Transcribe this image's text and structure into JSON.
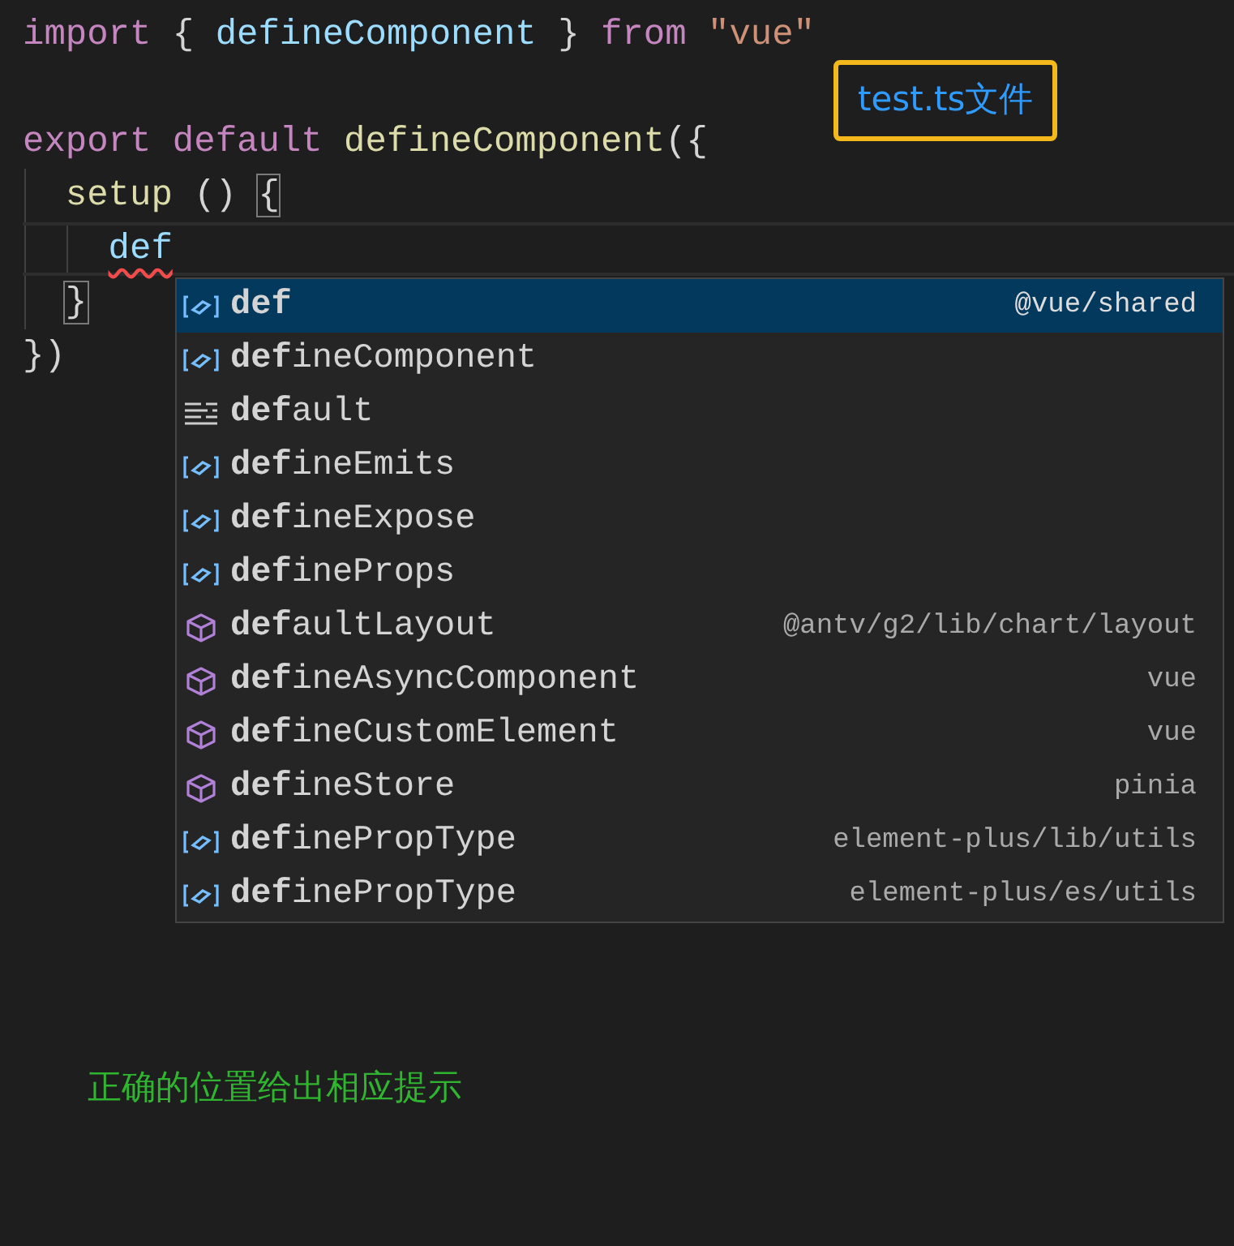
{
  "editor": {
    "blocks": [
      {
        "lines": [
          {
            "current": false,
            "tokens": [
              {
                "kind": "keyword",
                "text": "import"
              },
              {
                "kind": "punct",
                "text": " { "
              },
              {
                "kind": "ident",
                "text": "defineComponent"
              },
              {
                "kind": "punct",
                "text": " } "
              },
              {
                "kind": "keyword",
                "text": "from"
              },
              {
                "kind": "string",
                "text": " \"vue\""
              }
            ]
          }
        ]
      },
      {
        "lines": [
          {
            "current": false,
            "tokens": [
              {
                "kind": "keyword",
                "text": "export"
              },
              {
                "kind": "keyword",
                "text": " default"
              },
              {
                "kind": "function",
                "text": " defineComponent"
              },
              {
                "kind": "punct",
                "text": "({"
              }
            ],
            "children": [
              {
                "current": false,
                "tokens": [
                  {
                    "kind": "function",
                    "text": "setup"
                  },
                  {
                    "kind": "punct",
                    "text": " () "
                  },
                  {
                    "kind": "bracket",
                    "text": "{"
                  }
                ],
                "children": [
                  {
                    "current": true,
                    "tokens": [
                      {
                        "kind": "ident",
                        "text": "def",
                        "error": true
                      }
                    ]
                  }
                ]
              },
              {
                "current": false,
                "tokens": [
                  {
                    "kind": "bracket",
                    "text": "}"
                  }
                ]
              }
            ]
          },
          {
            "current": false,
            "tokens": [
              {
                "kind": "punct",
                "text": "})"
              }
            ]
          }
        ]
      }
    ]
  },
  "suggestions": [
    {
      "kind": "variable",
      "label": "**def**",
      "detail": "@vue/shared",
      "selected": true
    },
    {
      "kind": "variable",
      "label": "**def**ineComponent",
      "selected": false
    },
    {
      "kind": "text",
      "label": "**def**ault",
      "selected": false
    },
    {
      "kind": "variable",
      "label": "**def**ineEmits",
      "selected": false
    },
    {
      "kind": "variable",
      "label": "**def**ineExpose",
      "selected": false
    },
    {
      "kind": "variable",
      "label": "**def**ineProps",
      "selected": false
    },
    {
      "kind": "module",
      "label": "**def**aultLayout",
      "detail": "@antv/g2/lib/chart/layout",
      "selected": false
    },
    {
      "kind": "module",
      "label": "**def**ineAsyncComponent",
      "detail": "vue",
      "selected": false
    },
    {
      "kind": "module",
      "label": "**def**ineCustomElement",
      "detail": "vue",
      "selected": false
    },
    {
      "kind": "module",
      "label": "**def**ineStore",
      "detail": "pinia",
      "selected": false
    },
    {
      "kind": "variable",
      "label": "**def**inePropType",
      "detail": "element-plus/lib/utils",
      "selected": false
    },
    {
      "kind": "variable",
      "label": "**def**inePropType",
      "detail": "element-plus/es/utils",
      "selected": false
    }
  ],
  "file_callout": "test.ts文件",
  "caption": "正确的位置给出相应提示"
}
